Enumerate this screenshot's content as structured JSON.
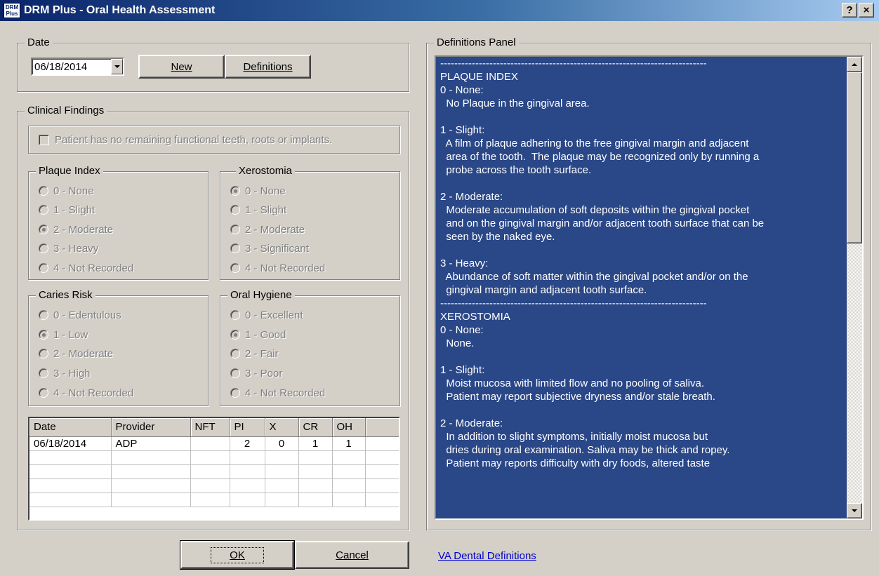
{
  "window": {
    "app_icon_text": "DRM Plus",
    "title": "DRM Plus - Oral Health Assessment",
    "help_label": "?",
    "close_label": "×"
  },
  "date_group": {
    "label": "Date",
    "selected_date": "06/18/2014",
    "new_button": "New",
    "definitions_button": "Definitions"
  },
  "clinical": {
    "label": "Clinical Findings",
    "no_teeth_label": "Patient has no remaining functional teeth, roots or implants.",
    "no_teeth_checked": false,
    "plaque_index": {
      "label": "Plaque Index",
      "options": [
        "0 - None",
        "1 - Slight",
        "2 - Moderate",
        "3 - Heavy",
        "4 - Not Recorded"
      ],
      "selected": 2
    },
    "xerostomia": {
      "label": "Xerostomia",
      "options": [
        "0 - None",
        "1 - Slight",
        "2 - Moderate",
        "3 - Significant",
        "4 - Not Recorded"
      ],
      "selected": 0
    },
    "caries_risk": {
      "label": "Caries Risk",
      "options": [
        "0 - Edentulous",
        "1 - Low",
        "2 - Moderate",
        "3 - High",
        "4 - Not Recorded"
      ],
      "selected": 1
    },
    "oral_hygiene": {
      "label": "Oral Hygiene",
      "options": [
        "0 - Excellent",
        "1 - Good",
        "2 - Fair",
        "3 - Poor",
        "4 - Not Recorded"
      ],
      "selected": 1
    }
  },
  "history_table": {
    "columns": [
      "Date",
      "Provider",
      "NFT",
      "PI",
      "X",
      "CR",
      "OH",
      ""
    ],
    "rows": [
      [
        "06/18/2014",
        "ADP",
        "",
        "2",
        "0",
        "1",
        "1",
        ""
      ],
      [
        "",
        "",
        "",
        "",
        "",
        "",
        "",
        ""
      ],
      [
        "",
        "",
        "",
        "",
        "",
        "",
        "",
        ""
      ],
      [
        "",
        "",
        "",
        "",
        "",
        "",
        "",
        ""
      ],
      [
        "",
        "",
        "",
        "",
        "",
        "",
        "",
        ""
      ]
    ]
  },
  "definitions_panel": {
    "label": "Definitions Panel",
    "text": "----------------------------------------------------------------------------\nPLAQUE INDEX\n0 - None:\n  No Plaque in the gingival area.\n\n1 - Slight:\n  A film of plaque adhering to the free gingival margin and adjacent\n  area of the tooth.  The plaque may be recognized only by running a\n  probe across the tooth surface.\n\n2 - Moderate:\n  Moderate accumulation of soft deposits within the gingival pocket\n  and on the gingival margin and/or adjacent tooth surface that can be\n  seen by the naked eye.\n\n3 - Heavy:\n  Abundance of soft matter within the gingival pocket and/or on the\n  gingival margin and adjacent tooth surface.\n----------------------------------------------------------------------------\nXEROSTOMIA\n0 - None:\n  None.\n\n1 - Slight:\n  Moist mucosa with limited flow and no pooling of saliva.\n  Patient may report subjective dryness and/or stale breath.\n\n2 - Moderate:\n  In addition to slight symptoms, initially moist mucosa but\n  dries during oral examination. Saliva may be thick and ropey.\n  Patient may reports difficulty with dry foods, altered taste"
  },
  "footer": {
    "ok_button": "OK",
    "cancel_button": "Cancel",
    "va_link": "VA Dental Definitions"
  },
  "colors": {
    "dialog_bg": "#d4d0c8",
    "titlebar_start": "#0a246a",
    "titlebar_end": "#a6caf0",
    "definitions_bg": "#2a4787",
    "link": "#0000cc"
  }
}
